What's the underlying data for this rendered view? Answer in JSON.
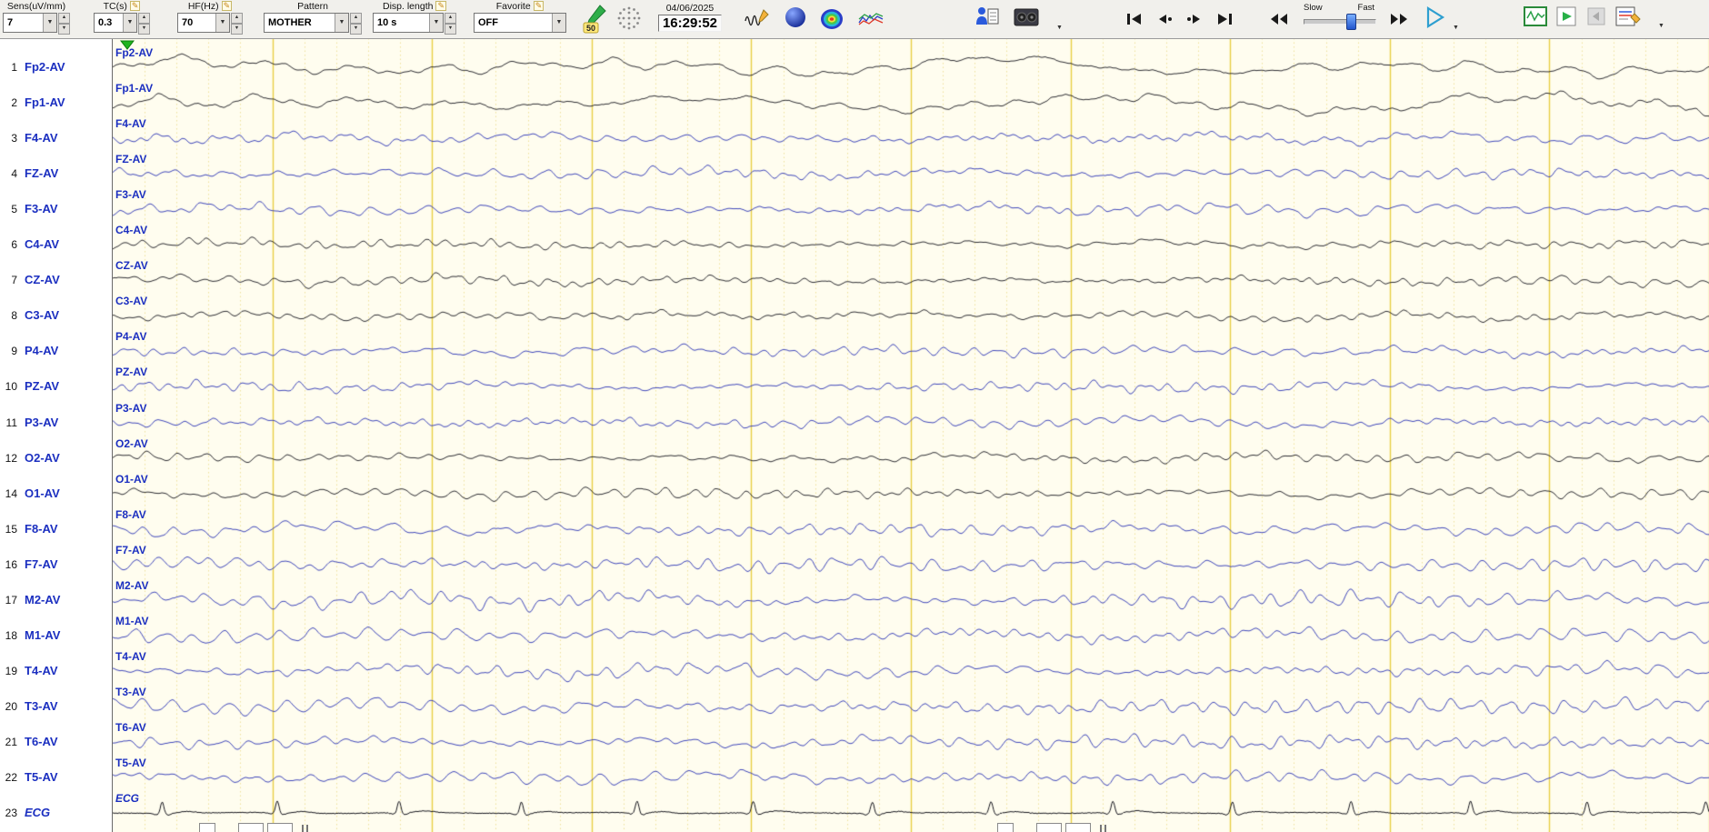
{
  "toolbar": {
    "sens": {
      "label": "Sens(uV/mm)",
      "value": "7"
    },
    "tc": {
      "label": "TC(s)",
      "value": "0.3"
    },
    "hf": {
      "label": "HF(Hz)",
      "value": "70"
    },
    "pattern": {
      "label": "Pattern",
      "value": "MOTHER"
    },
    "disp_length": {
      "label": "Disp. length",
      "value": "10 s"
    },
    "favorite": {
      "label": "Favorite",
      "value": "OFF"
    },
    "notch_badge": "50",
    "date": "04/06/2025",
    "time": "16:29:52",
    "slider": {
      "slow_label": "Slow",
      "fast_label": "Fast",
      "position_pct": 65
    }
  },
  "channels": [
    {
      "num": "1",
      "label": "Fp2-AV",
      "color": "black",
      "kind": "frontal"
    },
    {
      "num": "2",
      "label": "Fp1-AV",
      "color": "black",
      "kind": "frontal"
    },
    {
      "num": "3",
      "label": "F4-AV",
      "color": "blue",
      "kind": "mid"
    },
    {
      "num": "4",
      "label": "FZ-AV",
      "color": "blue",
      "kind": "mid"
    },
    {
      "num": "5",
      "label": "F3-AV",
      "color": "blue",
      "kind": "mid"
    },
    {
      "num": "6",
      "label": "C4-AV",
      "color": "black",
      "kind": "central"
    },
    {
      "num": "7",
      "label": "CZ-AV",
      "color": "black",
      "kind": "central"
    },
    {
      "num": "8",
      "label": "C3-AV",
      "color": "black",
      "kind": "central"
    },
    {
      "num": "9",
      "label": "P4-AV",
      "color": "blue",
      "kind": "posterior"
    },
    {
      "num": "10",
      "label": "PZ-AV",
      "color": "blue",
      "kind": "posterior"
    },
    {
      "num": "11",
      "label": "P3-AV",
      "color": "blue",
      "kind": "posterior"
    },
    {
      "num": "12",
      "label": "O2-AV",
      "color": "black",
      "kind": "posterior"
    },
    {
      "num": "14",
      "label": "O1-AV",
      "color": "black",
      "kind": "posterior"
    },
    {
      "num": "15",
      "label": "F8-AV",
      "color": "blue",
      "kind": "temporal"
    },
    {
      "num": "16",
      "label": "F7-AV",
      "color": "blue",
      "kind": "temporal"
    },
    {
      "num": "17",
      "label": "M2-AV",
      "color": "blue",
      "kind": "temporal"
    },
    {
      "num": "18",
      "label": "M1-AV",
      "color": "blue",
      "kind": "temporal"
    },
    {
      "num": "19",
      "label": "T4-AV",
      "color": "blue",
      "kind": "temporal"
    },
    {
      "num": "20",
      "label": "T3-AV",
      "color": "blue",
      "kind": "temporal"
    },
    {
      "num": "21",
      "label": "T6-AV",
      "color": "blue",
      "kind": "temporal"
    },
    {
      "num": "22",
      "label": "T5-AV",
      "color": "blue",
      "kind": "temporal"
    },
    {
      "num": "23",
      "label": "ECG",
      "color": "black",
      "kind": "ecg",
      "italic": true
    }
  ],
  "display": {
    "seconds_per_screen": 10,
    "grid_major_interval_s": 1,
    "grid_minor_interval_s": 0.2,
    "colors": {
      "plot_bg": "#fffdef",
      "grid_major": "#e8cf44",
      "grid_minor": "#efe39a",
      "trace_black": "#16161e",
      "trace_blue": "#2a33b4",
      "channel_label": "#1b2fc0",
      "marker_green": "#1fb41f"
    }
  }
}
